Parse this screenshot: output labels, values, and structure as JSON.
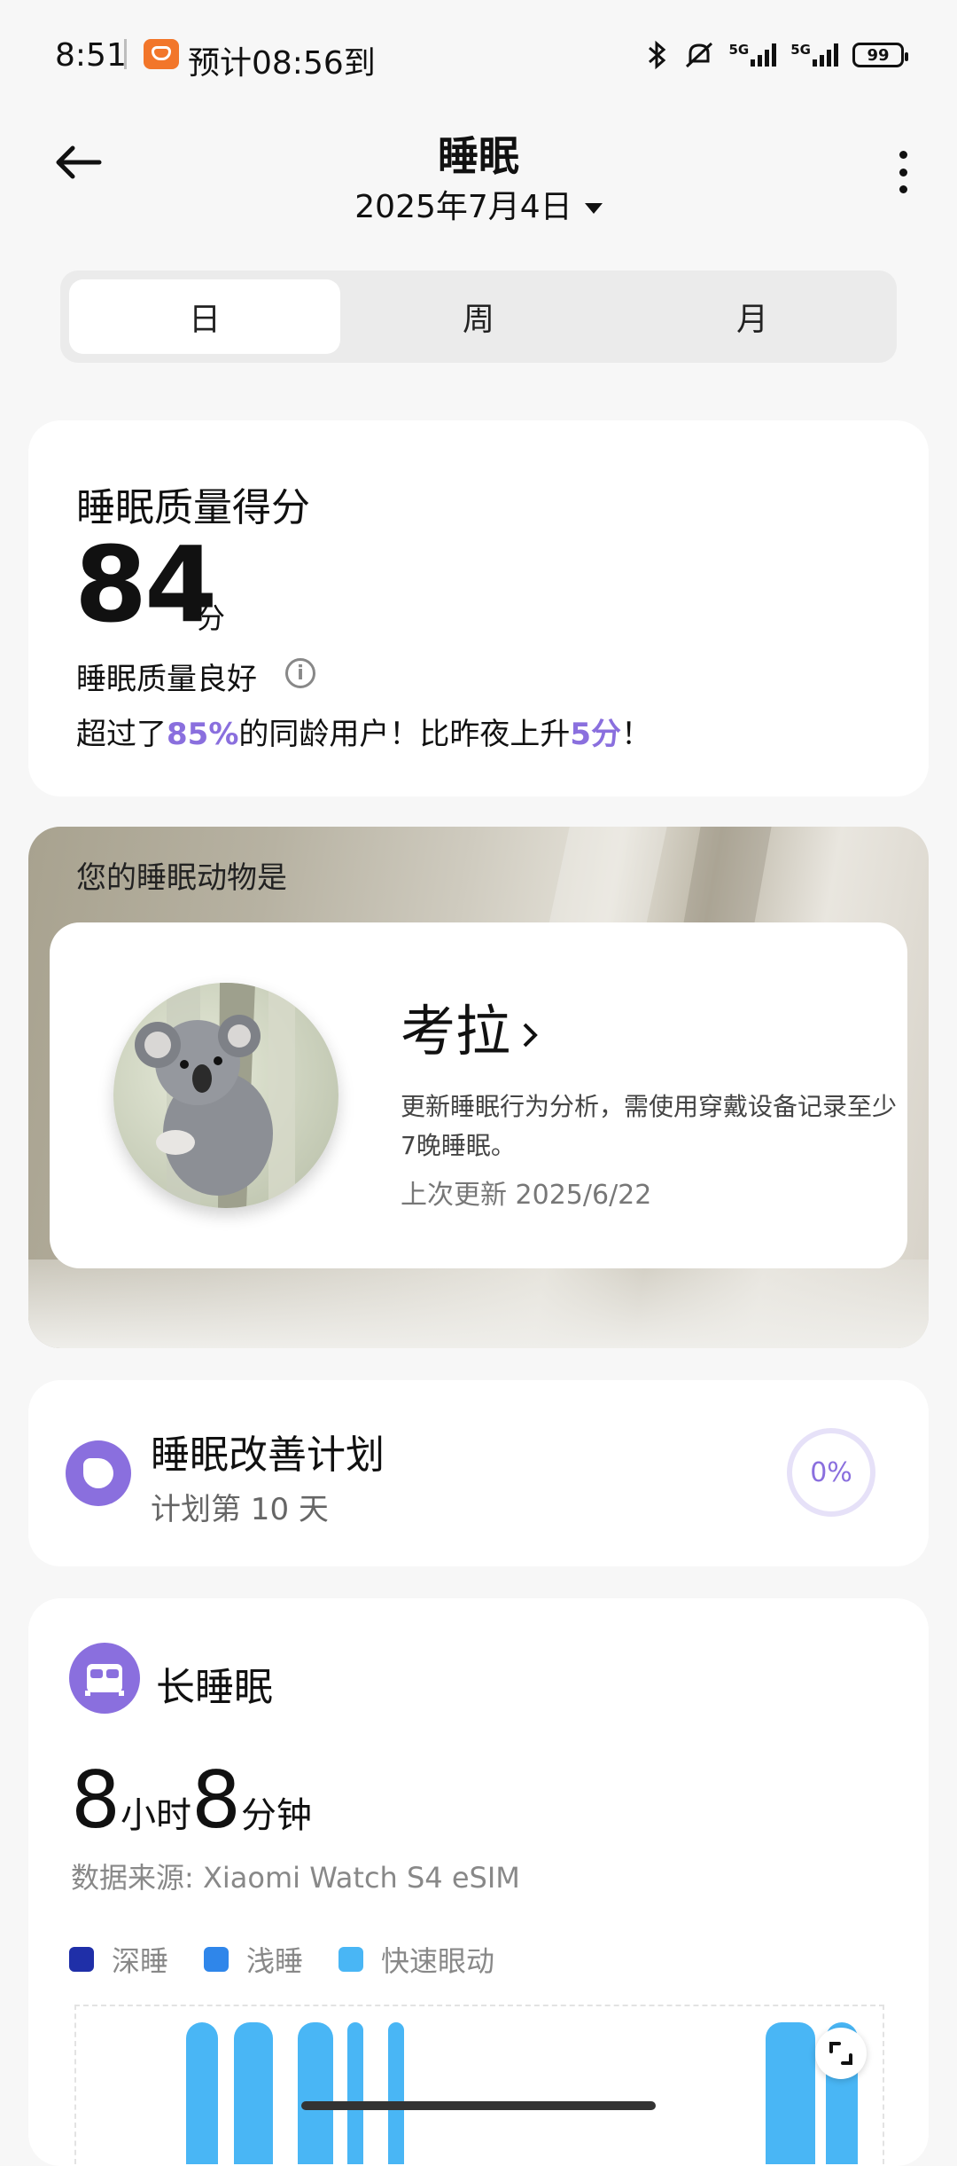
{
  "status_bar": {
    "time": "8:51",
    "eta": "预计08:56到",
    "network_a": "5G",
    "network_b": "5G",
    "battery": "99"
  },
  "header": {
    "title": "睡眠",
    "date": "2025年7月4日"
  },
  "tabs": [
    {
      "label": "日",
      "active": true
    },
    {
      "label": "周",
      "active": false
    },
    {
      "label": "月",
      "active": false
    }
  ],
  "score_card": {
    "title": "睡眠质量得分",
    "score": "84",
    "unit": "分",
    "quality": "睡眠质量良好",
    "compare_prefix": "超过了",
    "percent": "85%",
    "compare_mid": "的同龄用户！比昨夜上升",
    "rise": "5分",
    "compare_suffix": "！"
  },
  "animal_card": {
    "label": "您的睡眠动物是",
    "name": "考拉",
    "description": "更新睡眠行为分析，需使用穿戴设备记录至少7晚睡眠。",
    "updated": "上次更新 2025/6/22"
  },
  "plan_card": {
    "title": "睡眠改善计划",
    "day": "计划第 10 天",
    "progress": "0%"
  },
  "long_sleep": {
    "title": "长睡眠",
    "hours": "8",
    "hours_unit": "小时",
    "minutes": "8",
    "minutes_unit": "分钟",
    "source": "数据来源: Xiaomi Watch S4 eSIM",
    "legend": [
      {
        "label": "深睡",
        "color": "#1f2fa8"
      },
      {
        "label": "浅睡",
        "color": "#2f86ea"
      },
      {
        "label": "快速眼动",
        "color": "#49b6f5"
      }
    ]
  },
  "colors": {
    "accent": "#8a6fde",
    "background": "#f7f7f7"
  }
}
